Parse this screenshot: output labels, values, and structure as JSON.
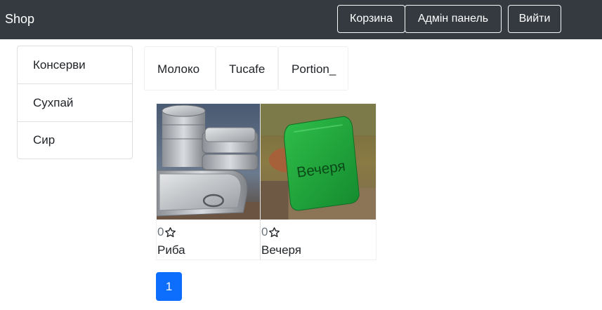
{
  "navbar": {
    "brand": "Shop",
    "cart_label": "Корзина",
    "admin_label": "Адмін панель",
    "logout_label": "Вийти"
  },
  "sidebar": {
    "items": [
      {
        "label": "Консерви"
      },
      {
        "label": "Сухпай"
      },
      {
        "label": "Сир"
      }
    ]
  },
  "brands": [
    {
      "label": "Молоко"
    },
    {
      "label": "Tucafe"
    },
    {
      "label": "Portion_"
    }
  ],
  "products": [
    {
      "rating": "0",
      "name": "Риба",
      "icon": "star-outline-icon"
    },
    {
      "rating": "0",
      "name": "Вечеря",
      "icon": "star-outline-icon"
    }
  ],
  "package_text": "Вечеря",
  "pagination": {
    "pages": [
      "1"
    ],
    "active": "1"
  },
  "colors": {
    "navbar_bg": "#343a40",
    "accent": "#0d6efd",
    "package_green": "#1ea33a"
  }
}
